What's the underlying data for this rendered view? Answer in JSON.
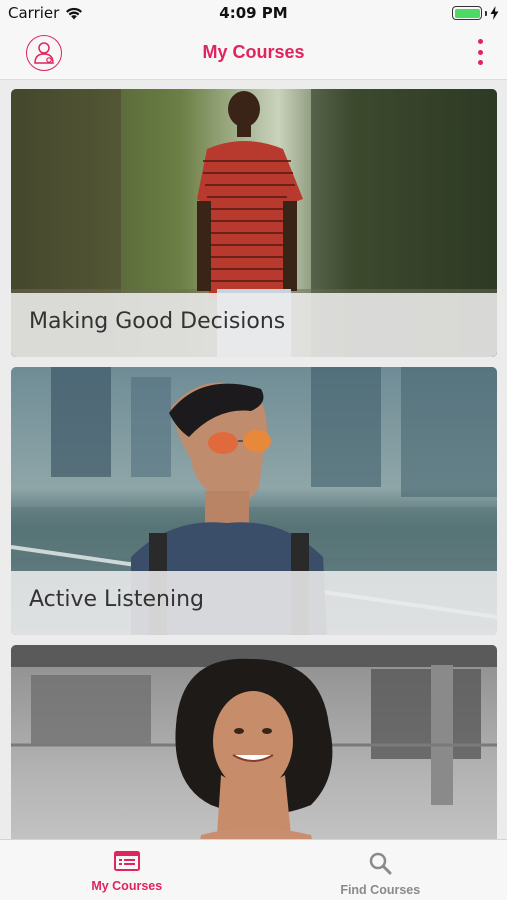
{
  "status_bar": {
    "carrier": "Carrier",
    "time": "4:09 PM",
    "battery_level": 1.0
  },
  "header": {
    "title": "My Courses",
    "profile_icon": "user-profile-icon",
    "menu_icon": "more-vertical-icon"
  },
  "courses": [
    {
      "title": "Making Good Decisions"
    },
    {
      "title": "Active Listening"
    },
    {
      "title": ""
    }
  ],
  "tabs": [
    {
      "label": "My Courses",
      "icon": "courses-list-icon",
      "active": true
    },
    {
      "label": "Find Courses",
      "icon": "search-icon",
      "active": false
    }
  ],
  "colors": {
    "accent": "#e0245e",
    "inactive": "#8a8a8a",
    "background": "#ececec"
  }
}
